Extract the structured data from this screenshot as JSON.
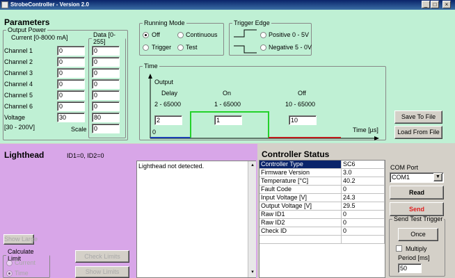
{
  "window": {
    "title": "StrobeController - Version 2.0",
    "min": "_",
    "max": "□",
    "close": "×"
  },
  "parameters": {
    "title": "Parameters",
    "output_power": {
      "legend": "Output Power",
      "current_label": "Current [0-8000 mA]",
      "data_legend": "Data [0-255]",
      "channels": [
        {
          "label": "Channel 1",
          "current": "0",
          "data": "0"
        },
        {
          "label": "Channel 2",
          "current": "0",
          "data": "0"
        },
        {
          "label": "Channel 3",
          "current": "0",
          "data": "0"
        },
        {
          "label": "Channel 4",
          "current": "0",
          "data": "0"
        },
        {
          "label": "Channel 5",
          "current": "0",
          "data": "0"
        },
        {
          "label": "Channel 6",
          "current": "0",
          "data": "0"
        }
      ],
      "voltage_label": "Voltage",
      "voltage_range": "[30 - 200V]",
      "voltage_value": "30",
      "voltage_data": "80",
      "scale_label": "Scale",
      "scale_value": "0"
    }
  },
  "running_mode": {
    "legend": "Running Mode",
    "off": "Off",
    "continuous": "Continuous",
    "trigger": "Trigger",
    "test": "Test",
    "selected": "Off"
  },
  "trigger_edge": {
    "legend": "Trigger Edge",
    "positive": "Positive 0 - 5V",
    "negative": "Negative 5 - 0V"
  },
  "time": {
    "legend": "Time",
    "output_label": "Output",
    "delay_label": "Delay",
    "delay_range": "2 - 65000",
    "delay_value": "2",
    "on_label": "On",
    "on_range": "1 - 65000",
    "on_value": "1",
    "off_label": "Off",
    "off_range": "10 - 65000",
    "off_value": "10",
    "origin": "0",
    "axis_label": "Time [µs]",
    "colors": {
      "delay": "#1a3fb4",
      "on": "#23d12a",
      "off": "#c01a1a"
    }
  },
  "buttons": {
    "save": "Save To File",
    "load": "Load From File"
  },
  "lighthead": {
    "title": "Lighthead",
    "ids": "ID1=0, ID2=0",
    "log": "Lighthead not detected.",
    "show_large": "Show Large",
    "calc_legend": "Calculate Limit",
    "current": "Current",
    "time": "Time",
    "check_limits": "Check Limits",
    "show_limits": "Show Limits"
  },
  "controller_status": {
    "title": "Controller Status",
    "rows": [
      {
        "name": "Controller Type",
        "value": "SC6"
      },
      {
        "name": "Firmware Version",
        "value": "3.0"
      },
      {
        "name": "Temperature [°C]",
        "value": "40.2"
      },
      {
        "name": "Fault Code",
        "value": "0"
      },
      {
        "name": "Input Voltage [V]",
        "value": "24.3"
      },
      {
        "name": "Output Voltage [V]",
        "value": "29.5"
      },
      {
        "name": "Raw ID1",
        "value": "0"
      },
      {
        "name": "Raw ID2",
        "value": "0"
      },
      {
        "name": "Check ID",
        "value": "0"
      }
    ]
  },
  "com": {
    "label": "COM Port",
    "selected": "COM1",
    "read": "Read",
    "send": "Send",
    "test_legend": "Send Test Trigger",
    "once": "Once",
    "multiply": "Multiply",
    "period_label": "Period [ms]",
    "period_value": "50"
  }
}
